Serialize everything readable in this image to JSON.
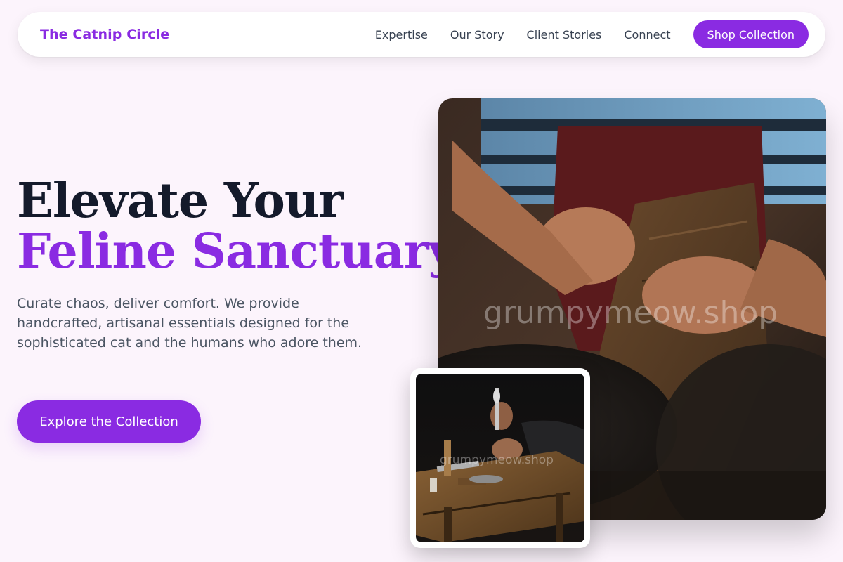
{
  "nav": {
    "brand": "The Catnip Circle",
    "links": [
      "Expertise",
      "Our Story",
      "Client Stories",
      "Connect"
    ],
    "cta": "Shop Collection"
  },
  "hero": {
    "title_line1": "Elevate Your",
    "title_line2": "Feline Sanctuary",
    "subtitle": "Curate chaos, deliver comfort. We provide handcrafted, artisanal essentials designed for the sophisticated cat and the humans who adore them.",
    "cta": "Explore the Collection"
  },
  "images": {
    "main_watermark": "grumpymeow.shop",
    "secondary_watermark": "grumpymeow.shop"
  },
  "colors": {
    "accent": "#8a2be2",
    "background": "#fcf4fc",
    "heading": "#141a2b",
    "body_text": "#4b5563"
  }
}
